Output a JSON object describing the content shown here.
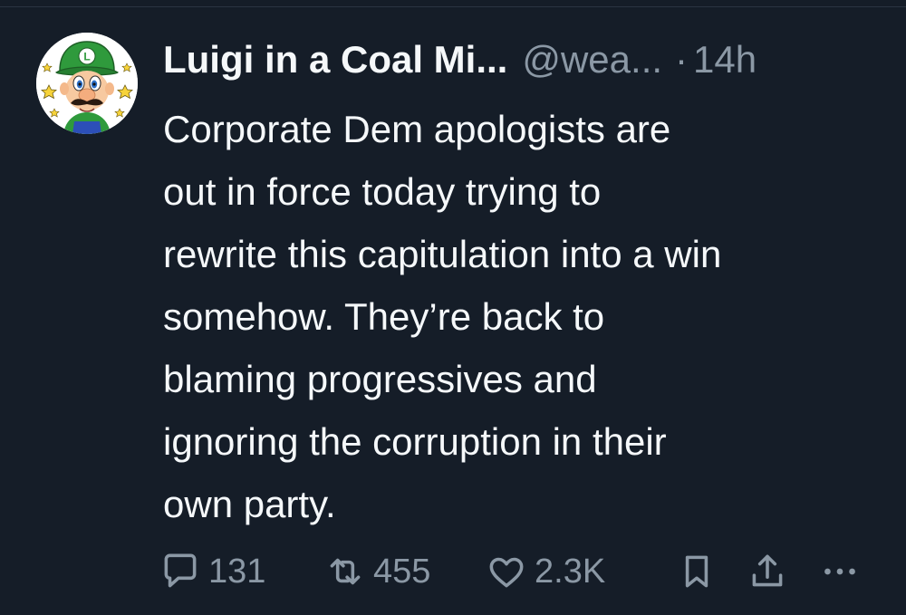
{
  "tweet": {
    "display_name": "Luigi in a Coal Mi...",
    "handle": "@wea...",
    "separator": "·",
    "time": "14h",
    "body_lines": [
      "Corporate Dem apologists are",
      "out in force today trying to",
      "rewrite this capitulation into a win",
      "somehow. They’re back to",
      "blaming progressives and",
      "ignoring the corruption in their",
      "own party."
    ],
    "avatar_icon": "luigi-avatar",
    "actions": {
      "reply": {
        "icon": "speech-bubble-icon",
        "count": "131"
      },
      "retweet": {
        "icon": "retweet-icon",
        "count": "455"
      },
      "like": {
        "icon": "heart-icon",
        "count": "2.3K"
      },
      "bookmark": {
        "icon": "bookmark-icon"
      },
      "share": {
        "icon": "share-upload-icon"
      },
      "more": {
        "icon": "ellipsis-icon"
      }
    }
  },
  "colors": {
    "background": "#151d28",
    "primary_text": "#f5f8fa",
    "secondary_text": "#8b98a5",
    "divider": "#2a3442"
  }
}
